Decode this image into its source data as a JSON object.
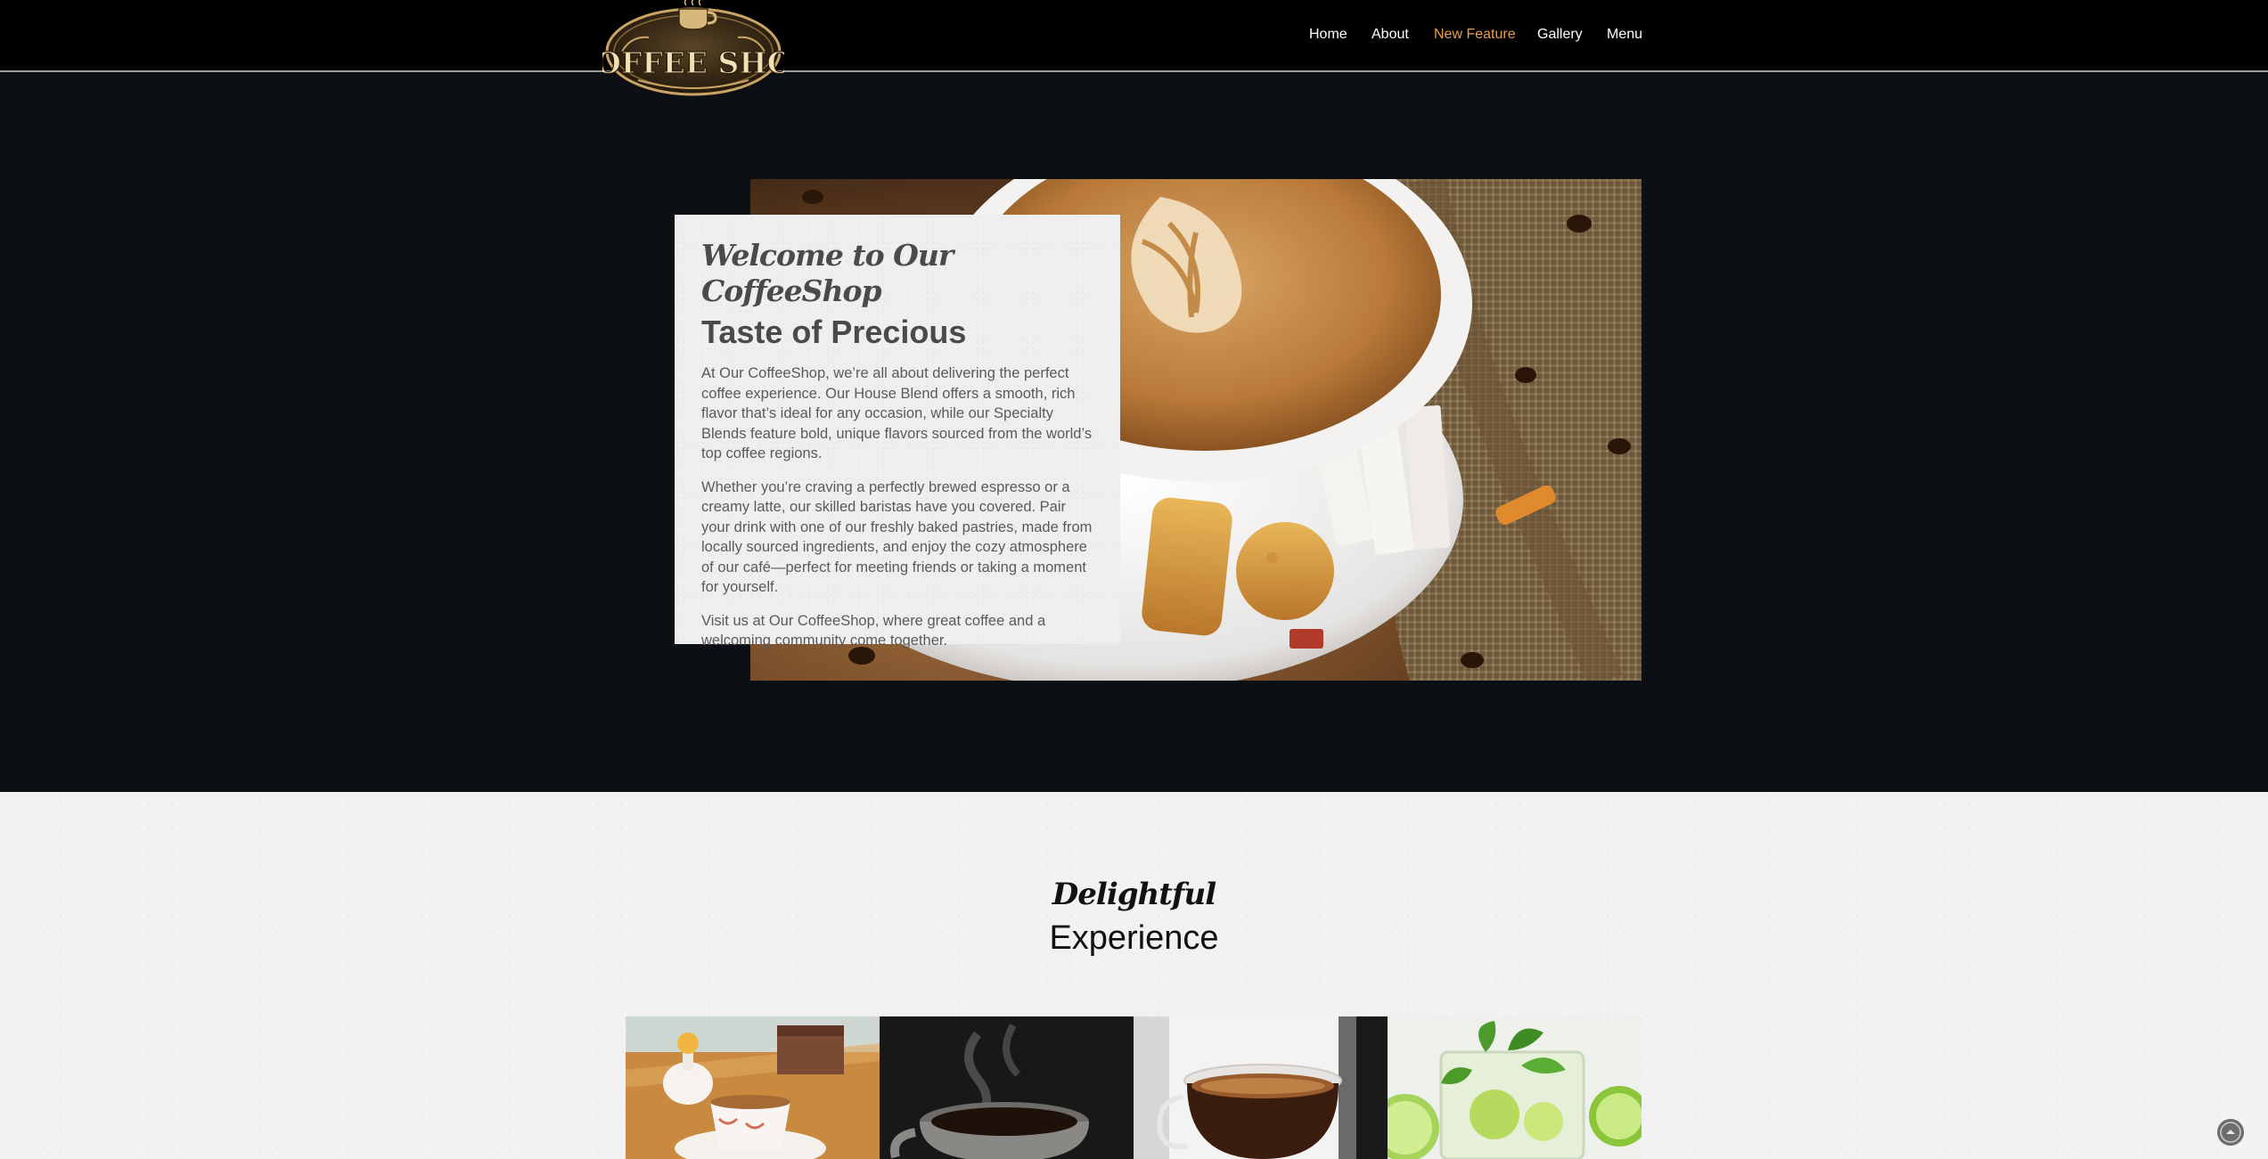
{
  "brand": {
    "logo_text": "COFFEE SHOP"
  },
  "nav": {
    "items": [
      {
        "label": "Home",
        "active": false
      },
      {
        "label": "About",
        "active": false
      },
      {
        "label": "New Feature",
        "active": true
      },
      {
        "label": "Gallery",
        "active": false
      },
      {
        "label": "Menu",
        "active": false
      }
    ]
  },
  "hero": {
    "title": "Welcome to Our CoffeeShop",
    "subtitle": "Taste of Precious",
    "paragraphs": [
      "At Our CoffeeShop, we’re all about delivering the perfect coffee experience. Our House Blend offers a smooth, rich flavor that’s ideal for any occasion, while our Specialty Blends feature bold, unique flavors sourced from the world’s top coffee regions.",
      "Whether you’re craving a perfectly brewed espresso or a creamy latte, our skilled baristas have you covered. Pair your drink with one of our freshly baked pastries, made from locally sourced ingredients, and enjoy the cozy atmosphere of our café—perfect for meeting friends or taking a moment for yourself.",
      "Visit us at Our CoffeeShop, where great coffee and a welcoming community come together."
    ]
  },
  "section": {
    "script_title": "Delightful",
    "title": "Experience"
  },
  "colors": {
    "accent": "#e6a04a",
    "header_bg": "#000000",
    "hero_bg": "#0c0f13",
    "section_bg": "#f2f2f2"
  },
  "icons": {
    "scroll_top": "chevron-up-icon"
  }
}
